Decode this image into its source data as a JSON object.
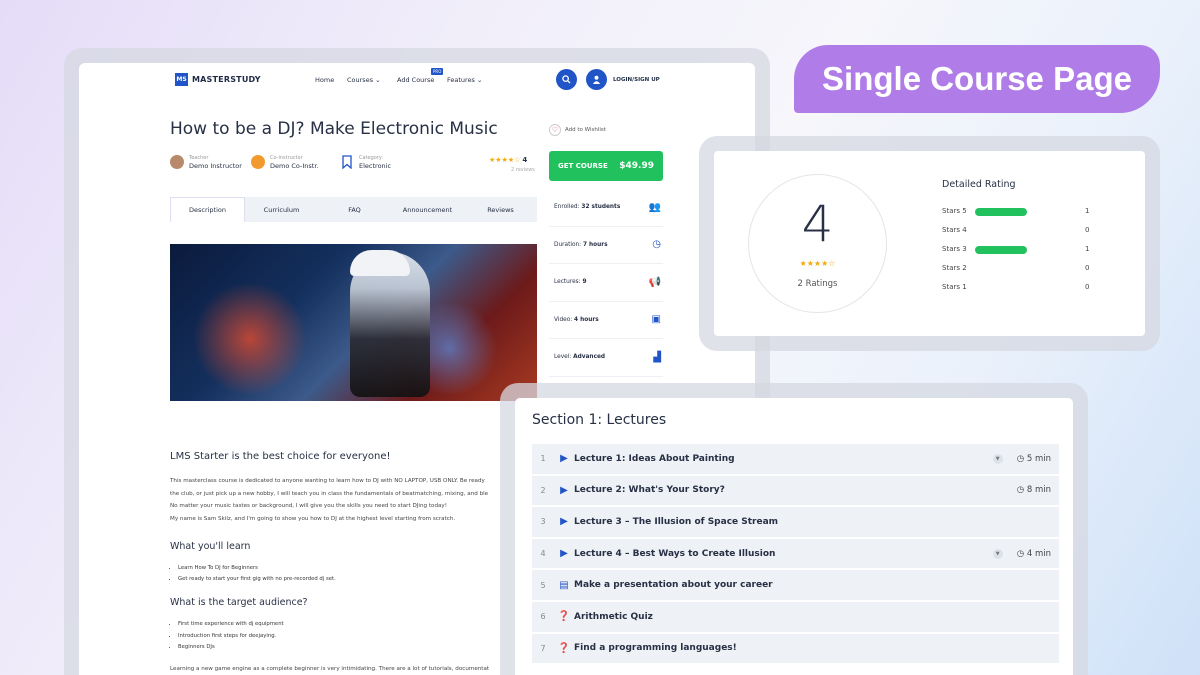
{
  "badge": {
    "title": "Single Course Page"
  },
  "nav": {
    "logo_mark": "MS",
    "logo_text": "MASTERSTUDY",
    "items": [
      "Home",
      "Courses",
      "Add Course",
      "Features"
    ],
    "pro_badge": "PRO",
    "login": "LOGIN/SIGN UP"
  },
  "course": {
    "title": "How to be a DJ? Make Electronic Music",
    "wishlist": "Add to Wishlist",
    "teacher_label": "Teacher",
    "teacher": "Demo Instructor",
    "coinstructor_label": "Co-instructor",
    "coinstructor": "Demo Co-Instr.",
    "category_label": "Category:",
    "category": "Electronic",
    "rating": "4",
    "reviews": "2 reviews",
    "cta_label": "GET COURSE",
    "price": "$49.99"
  },
  "tabs": [
    "Description",
    "Curriculum",
    "FAQ",
    "Announcement",
    "Reviews"
  ],
  "info": [
    {
      "label": "Enrolled:",
      "value": "32 students",
      "icon": "users-icon"
    },
    {
      "label": "Duration:",
      "value": "7 hours",
      "icon": "clock-icon"
    },
    {
      "label": "Lectures:",
      "value": "9",
      "icon": "megaphone-icon"
    },
    {
      "label": "Video:",
      "value": "4 hours",
      "icon": "video-icon"
    },
    {
      "label": "Level:",
      "value": "Advanced",
      "icon": "bar-chart-icon"
    }
  ],
  "description": {
    "heading": "LMS Starter is the best choice for everyone!",
    "lines": [
      "This masterclass course is dedicated to anyone wanting to learn how to DJ with NO LAPTOP, USB ONLY. Be ready",
      "the club, or just pick up a new hobby, I will teach you in class the fundamentals of beatmatching, mixing, and ble",
      "No matter your music tastes or background, I will give you the skills you need to start DJing today!",
      "My name is Sam Skilz, and I'm going to show you how to DJ at the highest level starting from scratch."
    ],
    "learn_heading": "What you'll learn",
    "learn_items": [
      "Learn How To DJ for Beginners",
      "Get ready to start your first gig with no pre-recorded dj set."
    ],
    "audience_heading": "What is the target audience?",
    "audience_items": [
      "First time experience with dj equipment",
      "Introduction first steps for deejaying.",
      "Beginners DJs"
    ],
    "bottom_line": "Learning a new game engine as a complete beginner is very intimidating. There are a lot of tutorials, documentat"
  },
  "rating_card": {
    "average": "4",
    "ratings_count": "2 Ratings",
    "detailed_title": "Detailed Rating",
    "rows": [
      {
        "label": "Stars 5",
        "count": "1",
        "fill": 1.0
      },
      {
        "label": "Stars 4",
        "count": "0",
        "fill": 0
      },
      {
        "label": "Stars 3",
        "count": "1",
        "fill": 1.0
      },
      {
        "label": "Stars 2",
        "count": "0",
        "fill": 0
      },
      {
        "label": "Stars 1",
        "count": "0",
        "fill": 0
      }
    ]
  },
  "curriculum": {
    "section_title": "Section 1: Lectures",
    "lectures": [
      {
        "num": "1",
        "name": "Lecture 1: Ideas About Painting",
        "icon": "play-icon",
        "duration": "5 min",
        "expandable": true
      },
      {
        "num": "2",
        "name": "Lecture 2: What's Your Story?",
        "icon": "play-icon",
        "duration": "8 min",
        "expandable": false
      },
      {
        "num": "3",
        "name": "Lecture 3 – The Illusion of Space Stream",
        "icon": "youtube-icon",
        "duration": "",
        "expandable": false
      },
      {
        "num": "4",
        "name": "Lecture 4 – Best Ways to Create Illusion",
        "icon": "play-icon",
        "duration": "4 min",
        "expandable": true
      },
      {
        "num": "5",
        "name": "Make a presentation about your career",
        "icon": "document-icon",
        "duration": "",
        "expandable": false
      },
      {
        "num": "6",
        "name": "Arithmetic Quiz",
        "icon": "quiz-icon",
        "duration": "",
        "expandable": false
      },
      {
        "num": "7",
        "name": "Find a programming languages!",
        "icon": "quiz-icon",
        "duration": "",
        "expandable": false
      }
    ]
  },
  "colors": {
    "accent": "#2154c6",
    "green": "#21c25e",
    "badge": "#b07de8",
    "star": "#f4a90c"
  }
}
